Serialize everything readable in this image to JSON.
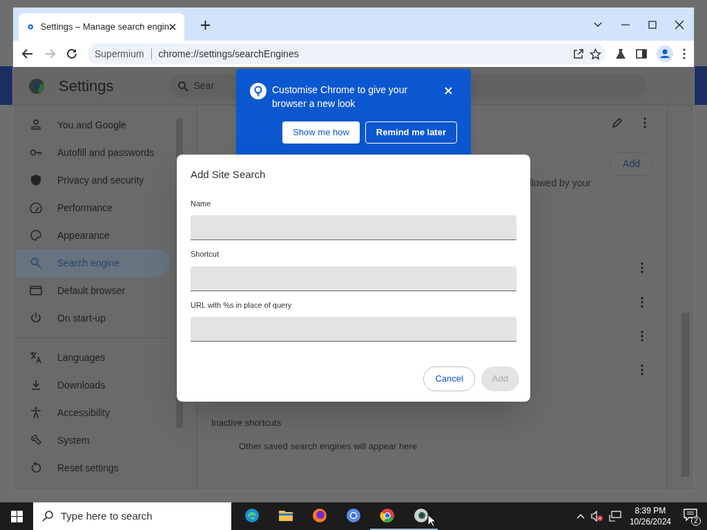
{
  "browser": {
    "tabs": [
      {
        "title": "Settings – Manage search engin",
        "selected": true
      }
    ],
    "address_bar": {
      "site": "Supermium",
      "url": "chrome://settings/searchEngines"
    }
  },
  "settings": {
    "title": "Settings",
    "search": {
      "placeholder": "Sear"
    },
    "sidebar": {
      "groups": [
        [
          {
            "label": "You and Google",
            "selected": false
          },
          {
            "label": "Autofill and passwords",
            "selected": false
          },
          {
            "label": "Privacy and security",
            "selected": false
          },
          {
            "label": "Performance",
            "selected": false
          },
          {
            "label": "Appearance",
            "selected": false
          },
          {
            "label": "Search engine",
            "selected": true
          },
          {
            "label": "Default browser",
            "selected": false
          },
          {
            "label": "On start-up",
            "selected": false
          }
        ],
        [
          {
            "label": "Languages",
            "selected": false
          },
          {
            "label": "Downloads",
            "selected": false
          },
          {
            "label": "Accessibility",
            "selected": false
          },
          {
            "label": "System",
            "selected": false
          },
          {
            "label": "Reset settings",
            "selected": false
          }
        ]
      ]
    },
    "main": {
      "add_button": "Add",
      "note": "llowed by your",
      "inactive_heading": "Inactive shortcuts",
      "empty_text": "Other saved search engines will appear here"
    }
  },
  "promo": {
    "text": "Customise Chrome to give your browser a new look",
    "buttons": [
      {
        "label": "Show me how",
        "kind": "primary"
      },
      {
        "label": "Remind me later",
        "kind": "outline"
      }
    ]
  },
  "dialog": {
    "title": "Add Site Search",
    "fields": [
      {
        "label": "Name"
      },
      {
        "label": "Shortcut"
      },
      {
        "label": "URL with %s in place of query"
      }
    ],
    "buttons": [
      {
        "label": "Cancel",
        "disabled": false
      },
      {
        "label": "Add",
        "disabled": true
      }
    ]
  },
  "taskbar": {
    "search": {
      "placeholder": "Type here to search"
    },
    "apps": [
      {
        "kind": "edge",
        "running": false
      },
      {
        "kind": "folder",
        "running": false
      },
      {
        "kind": "firefox",
        "running": false
      },
      {
        "kind": "chromium",
        "running": false
      },
      {
        "kind": "chrome",
        "running": true
      },
      {
        "kind": "supermium",
        "running": true
      }
    ],
    "clock": {
      "time": "8:39 PM",
      "date": "10/26/2024"
    },
    "notifications": "2"
  }
}
